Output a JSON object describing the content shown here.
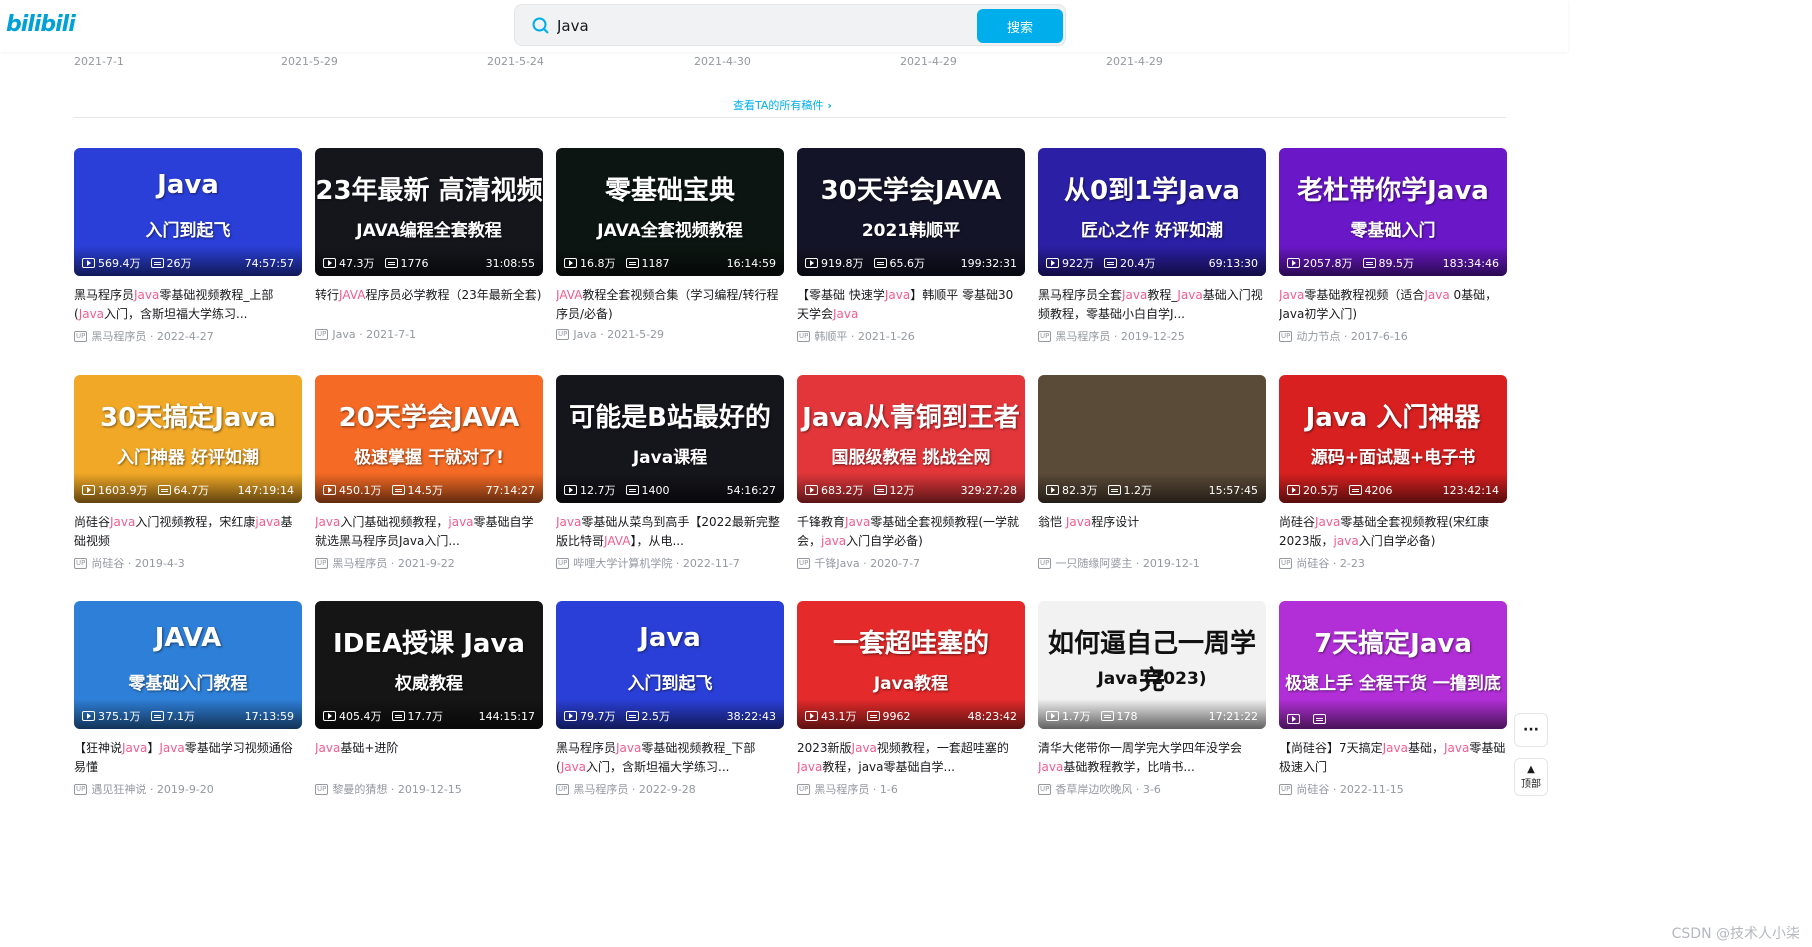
{
  "header": {
    "logo": "bilibili",
    "search_value": "Java",
    "search_button": "搜索"
  },
  "prev_dates": [
    "2021-7-1",
    "2021-5-29",
    "2021-5-24",
    "2021-4-30",
    "2021-4-29",
    "2021-4-29"
  ],
  "view_all": "查看TA的所有稿件",
  "videos": [
    {
      "thumb_line1": "Java",
      "thumb_line2": "入门到起飞",
      "bg": "#2a3fd8",
      "views": "569.4万",
      "danmaku": "26万",
      "duration": "74:57:57",
      "title_parts": [
        "黑马程序员",
        "Java",
        "零基础视频教程_上部(",
        "Java",
        "入门，含斯坦福大学练习..."
      ],
      "uploader": "黑马程序员",
      "date": "2022-4-27"
    },
    {
      "thumb_line1": "23年最新 高清视频",
      "thumb_line2": "JAVA编程全套教程",
      "bg": "#15161c",
      "views": "47.3万",
      "danmaku": "1776",
      "duration": "31:08:55",
      "title_parts": [
        "转行",
        "JAVA",
        "程序员必学教程（23年最新全套)",
        "",
        ""
      ],
      "uploader": "Java",
      "date": "2021-7-1"
    },
    {
      "thumb_line1": "零基础宝典",
      "thumb_line2": "JAVA全套视频教程",
      "bg": "#0c1511",
      "views": "16.8万",
      "danmaku": "1187",
      "duration": "16:14:59",
      "title_parts": [
        "",
        "JAVA",
        "教程全套视频合集（学习编程/转行程序员/必备)",
        "",
        ""
      ],
      "uploader": "Java",
      "date": "2021-5-29"
    },
    {
      "thumb_line1": "30天学会JAVA",
      "thumb_line2": "2021韩顺平",
      "bg": "#141428",
      "views": "919.8万",
      "danmaku": "65.6万",
      "duration": "199:32:31",
      "title_parts": [
        "【零基础 快速学",
        "Java",
        "】韩顺平 零基础30天学会",
        "Java",
        ""
      ],
      "uploader": "韩顺平",
      "date": "2021-1-26"
    },
    {
      "thumb_line1": "从0到1学Java",
      "thumb_line2": "匠心之作 好评如潮",
      "bg": "#2b1fa5",
      "views": "922万",
      "danmaku": "20.4万",
      "duration": "69:13:30",
      "title_parts": [
        "黑马程序员全套",
        "Java",
        "教程_",
        "Java",
        "基础入门视频教程，零基础小白自学J..."
      ],
      "uploader": "黑马程序员",
      "date": "2019-12-25"
    },
    {
      "thumb_line1": "老杜带你学Java",
      "thumb_line2": "零基础入门",
      "bg": "#6a17c8",
      "views": "2057.8万",
      "danmaku": "89.5万",
      "duration": "183:34:46",
      "title_parts": [
        "",
        "Java",
        "零基础教程视频（适合",
        "Java",
        " 0基础，Java初学入门)"
      ],
      "uploader": "动力节点",
      "date": "2017-6-16"
    },
    {
      "thumb_line1": "30天搞定Java",
      "thumb_line2": "入门神器 好评如潮",
      "bg": "#f1a826",
      "views": "1603.9万",
      "danmaku": "64.7万",
      "duration": "147:19:14",
      "title_parts": [
        "尚硅谷",
        "Java",
        "入门视频教程，宋红康",
        "java",
        "基础视频"
      ],
      "uploader": "尚硅谷",
      "date": "2019-4-3"
    },
    {
      "thumb_line1": "20天学会JAVA",
      "thumb_line2": "极速掌握 干就对了!",
      "bg": "#f56a24",
      "views": "450.1万",
      "danmaku": "14.5万",
      "duration": "77:14:27",
      "title_parts": [
        "",
        "Java",
        "入门基础视频教程，",
        "java",
        "零基础自学就选黑马程序员Java入门..."
      ],
      "uploader": "黑马程序员",
      "date": "2021-9-22"
    },
    {
      "thumb_line1": "可能是B站最好的",
      "thumb_line2": "Java课程",
      "bg": "#15151c",
      "views": "12.7万",
      "danmaku": "1400",
      "duration": "54:16:27",
      "title_parts": [
        "",
        "Java",
        "零基础从菜鸟到高手【2022最新完整版比特哥",
        "JAVA",
        "】，从电..."
      ],
      "uploader": "哔哩大学计算机学院",
      "date": "2022-11-7"
    },
    {
      "thumb_line1": "Java从青铜到王者",
      "thumb_line2": "国服级教程 挑战全网",
      "bg": "#e2363a",
      "views": "683.2万",
      "danmaku": "12万",
      "duration": "329:27:28",
      "title_parts": [
        "千锋教育",
        "Java",
        "零基础全套视频教程(一学就会，",
        "java",
        "入门自学必备)"
      ],
      "uploader": "千锋Java",
      "date": "2020-7-7"
    },
    {
      "thumb_line1": "",
      "thumb_line2": "",
      "bg": "#5a4a38",
      "views": "82.3万",
      "danmaku": "1.2万",
      "duration": "15:57:45",
      "title_parts": [
        "翁恺 ",
        "Java",
        "程序设计",
        "",
        ""
      ],
      "uploader": "一只随缘阿婆主",
      "date": "2019-12-1"
    },
    {
      "thumb_line1": "Java 入门神器",
      "thumb_line2": "源码+面试题+电子书",
      "bg": "#d82020",
      "views": "20.5万",
      "danmaku": "4206",
      "duration": "123:42:14",
      "title_parts": [
        "尚硅谷",
        "Java",
        "零基础全套视频教程(宋红康2023版，",
        "java",
        "入门自学必备)"
      ],
      "uploader": "尚硅谷",
      "date": "2-23"
    },
    {
      "thumb_line1": "JAVA",
      "thumb_line2": "零基础入门教程",
      "bg": "#2e7fd8",
      "views": "375.1万",
      "danmaku": "7.1万",
      "duration": "17:13:59",
      "title_parts": [
        "【狂神说",
        "Java",
        "】",
        "Java",
        "零基础学习视频通俗易懂"
      ],
      "uploader": "遇见狂神说",
      "date": "2019-9-20"
    },
    {
      "thumb_line1": "IDEA授课 Java",
      "thumb_line2": "权威教程",
      "bg": "#151515",
      "views": "405.4万",
      "danmaku": "17.7万",
      "duration": "144:15:17",
      "title_parts": [
        "",
        "Java",
        "基础+进阶",
        "",
        ""
      ],
      "uploader": "黎曼的猜想",
      "date": "2019-12-15"
    },
    {
      "thumb_line1": "Java",
      "thumb_line2": "入门到起飞",
      "bg": "#2a3fd8",
      "views": "79.7万",
      "danmaku": "2.5万",
      "duration": "38:22:43",
      "title_parts": [
        "黑马程序员",
        "Java",
        "零基础视频教程_下部(",
        "Java",
        "入门，含斯坦福大学练习..."
      ],
      "uploader": "黑马程序员",
      "date": "2022-9-28"
    },
    {
      "thumb_line1": "一套超哇塞的",
      "thumb_line2": "Java教程",
      "bg": "#e42a2a",
      "views": "43.1万",
      "danmaku": "9962",
      "duration": "48:23:42",
      "title_parts": [
        "2023新版",
        "Java",
        "视频教程，一套超哇塞的",
        "Java",
        "教程，java零基础自学..."
      ],
      "uploader": "黑马程序员",
      "date": "1-6"
    },
    {
      "thumb_line1": "如何逼自己一周学完",
      "thumb_line2": "Java (2023)",
      "bg": "#f2f2f2",
      "views": "1.7万",
      "danmaku": "178",
      "duration": "17:21:22",
      "title_parts": [
        "清华大佬带你一周学完大学四年没学会",
        "Java",
        "基础教程教学，比啃书...",
        "",
        ""
      ],
      "uploader": "香草岸边吹晚风",
      "date": "3-6"
    },
    {
      "thumb_line1": "7天搞定Java",
      "thumb_line2": "极速上手 全程干货 一撸到底",
      "bg": "#b22fd8",
      "views": "",
      "danmaku": "",
      "duration": "",
      "title_parts": [
        "【尚硅谷】7天搞定",
        "Java",
        "基础，",
        "Java",
        "零基础极速入门"
      ],
      "uploader": "尚硅谷",
      "date": "2022-11-15"
    }
  ],
  "side": {
    "more_label": "···",
    "top_label": "顶部"
  },
  "watermark": "CSDN @技术人小柒"
}
